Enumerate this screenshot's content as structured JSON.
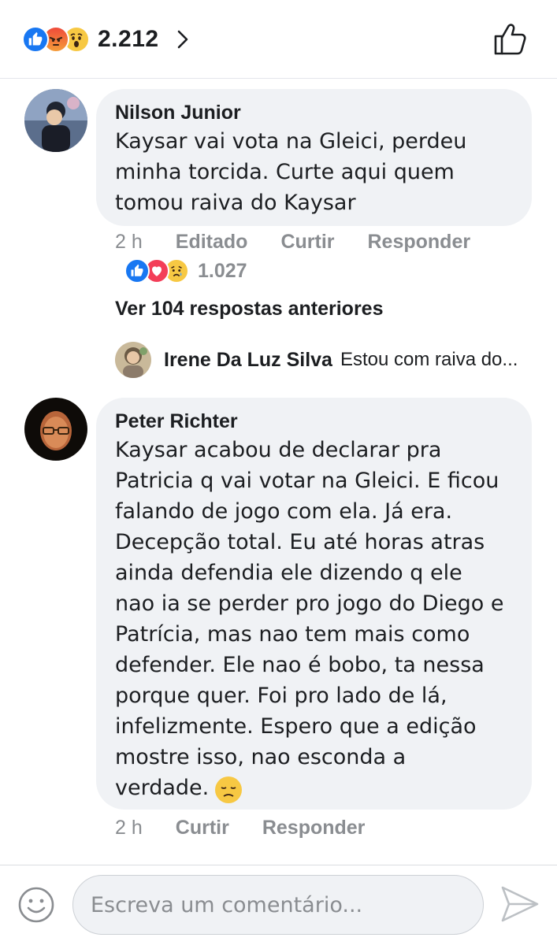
{
  "header": {
    "reaction_icons": [
      "like-icon",
      "angry-icon",
      "wow-icon"
    ],
    "reaction_count": "2.212",
    "colors": {
      "like": "#1877f2",
      "love": "#f33e58",
      "angry": "#e9710f",
      "wow": "#f7c843"
    }
  },
  "comments": [
    {
      "author": "Nilson Junior",
      "text": "Kaysar vai vota na Gleici, perdeu\nminha torcida. Curte aqui quem\ntomou raiva do Kaysar",
      "time": "2 h",
      "edited_label": "Editado",
      "like_label": "Curtir",
      "reply_label": "Responder",
      "reaction_icons": [
        "like-icon",
        "love-icon",
        "sad-icon"
      ],
      "reaction_count": "1.027",
      "see_more": "Ver 104 respostas anteriores",
      "reply": {
        "author": "Irene Da Luz Silva",
        "text": "Estou com raiva do..."
      }
    },
    {
      "author": "Peter Richter",
      "text": "Kaysar acabou de declarar pra\nPatricia q vai votar na Gleici. E ficou\nfalando de jogo com ela. Já era.\nDecepção total. Eu até horas atras\nainda defendia ele dizendo q ele\nnao ia se perder pro jogo do Diego e\nPatrícia, mas nao tem mais como\ndefender. Ele nao é bobo, ta nessa\nporque quer. Foi pro lado de lá,\ninfelizmente. Espero que a edição\nmostre isso, nao esconda a\nverdade.",
      "emoji": "disappointed-face-icon",
      "time": "2 h",
      "like_label": "Curtir",
      "reply_label": "Responder"
    }
  ],
  "composer": {
    "placeholder": "Escreva um comentário...",
    "emoji_icon": "emoji-icon",
    "send_icon": "send-icon"
  }
}
